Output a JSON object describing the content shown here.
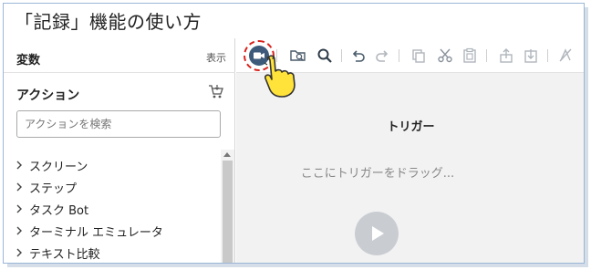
{
  "title": "「記録」機能の使い方",
  "variables": {
    "title": "変数",
    "show_label": "表示"
  },
  "actions": {
    "title": "アクション",
    "search_placeholder": "アクションを検索",
    "items": [
      {
        "label": "スクリーン"
      },
      {
        "label": "ステップ"
      },
      {
        "label": "タスク Bot"
      },
      {
        "label": "ターミナル エミュレータ"
      },
      {
        "label": "テキスト比較"
      }
    ]
  },
  "toolbar": {
    "buttons": [
      "record-icon",
      "find-icon",
      "search-icon",
      "undo-icon",
      "redo-icon",
      "copy-icon",
      "cut-icon",
      "paste-icon",
      "upload-icon",
      "download-icon",
      "disable-icon"
    ]
  },
  "canvas": {
    "trigger_label": "トリガー",
    "drop_hint": "ここにトリガーをドラッグ..."
  },
  "colors": {
    "record_button": "#3d5a7a",
    "highlight_ring": "#d8231c",
    "frame_border": "#9bb7d6",
    "canvas_bg": "#f2f2f2"
  }
}
